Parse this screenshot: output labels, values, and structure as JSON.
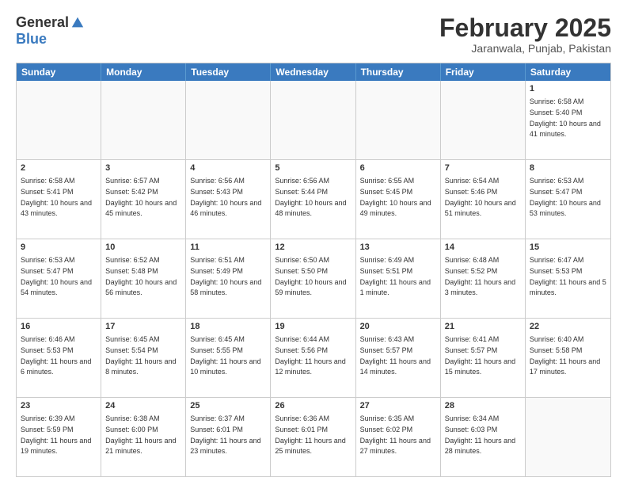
{
  "header": {
    "logo_general": "General",
    "logo_blue": "Blue",
    "month_title": "February 2025",
    "location": "Jaranwala, Punjab, Pakistan"
  },
  "days_of_week": [
    "Sunday",
    "Monday",
    "Tuesday",
    "Wednesday",
    "Thursday",
    "Friday",
    "Saturday"
  ],
  "weeks": [
    [
      {
        "day": "",
        "text": "",
        "empty": true
      },
      {
        "day": "",
        "text": "",
        "empty": true
      },
      {
        "day": "",
        "text": "",
        "empty": true
      },
      {
        "day": "",
        "text": "",
        "empty": true
      },
      {
        "day": "",
        "text": "",
        "empty": true
      },
      {
        "day": "",
        "text": "",
        "empty": true
      },
      {
        "day": "1",
        "text": "Sunrise: 6:58 AM\nSunset: 5:40 PM\nDaylight: 10 hours and 41 minutes.",
        "empty": false
      }
    ],
    [
      {
        "day": "2",
        "text": "Sunrise: 6:58 AM\nSunset: 5:41 PM\nDaylight: 10 hours and 43 minutes.",
        "empty": false
      },
      {
        "day": "3",
        "text": "Sunrise: 6:57 AM\nSunset: 5:42 PM\nDaylight: 10 hours and 45 minutes.",
        "empty": false
      },
      {
        "day": "4",
        "text": "Sunrise: 6:56 AM\nSunset: 5:43 PM\nDaylight: 10 hours and 46 minutes.",
        "empty": false
      },
      {
        "day": "5",
        "text": "Sunrise: 6:56 AM\nSunset: 5:44 PM\nDaylight: 10 hours and 48 minutes.",
        "empty": false
      },
      {
        "day": "6",
        "text": "Sunrise: 6:55 AM\nSunset: 5:45 PM\nDaylight: 10 hours and 49 minutes.",
        "empty": false
      },
      {
        "day": "7",
        "text": "Sunrise: 6:54 AM\nSunset: 5:46 PM\nDaylight: 10 hours and 51 minutes.",
        "empty": false
      },
      {
        "day": "8",
        "text": "Sunrise: 6:53 AM\nSunset: 5:47 PM\nDaylight: 10 hours and 53 minutes.",
        "empty": false
      }
    ],
    [
      {
        "day": "9",
        "text": "Sunrise: 6:53 AM\nSunset: 5:47 PM\nDaylight: 10 hours and 54 minutes.",
        "empty": false
      },
      {
        "day": "10",
        "text": "Sunrise: 6:52 AM\nSunset: 5:48 PM\nDaylight: 10 hours and 56 minutes.",
        "empty": false
      },
      {
        "day": "11",
        "text": "Sunrise: 6:51 AM\nSunset: 5:49 PM\nDaylight: 10 hours and 58 minutes.",
        "empty": false
      },
      {
        "day": "12",
        "text": "Sunrise: 6:50 AM\nSunset: 5:50 PM\nDaylight: 10 hours and 59 minutes.",
        "empty": false
      },
      {
        "day": "13",
        "text": "Sunrise: 6:49 AM\nSunset: 5:51 PM\nDaylight: 11 hours and 1 minute.",
        "empty": false
      },
      {
        "day": "14",
        "text": "Sunrise: 6:48 AM\nSunset: 5:52 PM\nDaylight: 11 hours and 3 minutes.",
        "empty": false
      },
      {
        "day": "15",
        "text": "Sunrise: 6:47 AM\nSunset: 5:53 PM\nDaylight: 11 hours and 5 minutes.",
        "empty": false
      }
    ],
    [
      {
        "day": "16",
        "text": "Sunrise: 6:46 AM\nSunset: 5:53 PM\nDaylight: 11 hours and 6 minutes.",
        "empty": false
      },
      {
        "day": "17",
        "text": "Sunrise: 6:45 AM\nSunset: 5:54 PM\nDaylight: 11 hours and 8 minutes.",
        "empty": false
      },
      {
        "day": "18",
        "text": "Sunrise: 6:45 AM\nSunset: 5:55 PM\nDaylight: 11 hours and 10 minutes.",
        "empty": false
      },
      {
        "day": "19",
        "text": "Sunrise: 6:44 AM\nSunset: 5:56 PM\nDaylight: 11 hours and 12 minutes.",
        "empty": false
      },
      {
        "day": "20",
        "text": "Sunrise: 6:43 AM\nSunset: 5:57 PM\nDaylight: 11 hours and 14 minutes.",
        "empty": false
      },
      {
        "day": "21",
        "text": "Sunrise: 6:41 AM\nSunset: 5:57 PM\nDaylight: 11 hours and 15 minutes.",
        "empty": false
      },
      {
        "day": "22",
        "text": "Sunrise: 6:40 AM\nSunset: 5:58 PM\nDaylight: 11 hours and 17 minutes.",
        "empty": false
      }
    ],
    [
      {
        "day": "23",
        "text": "Sunrise: 6:39 AM\nSunset: 5:59 PM\nDaylight: 11 hours and 19 minutes.",
        "empty": false
      },
      {
        "day": "24",
        "text": "Sunrise: 6:38 AM\nSunset: 6:00 PM\nDaylight: 11 hours and 21 minutes.",
        "empty": false
      },
      {
        "day": "25",
        "text": "Sunrise: 6:37 AM\nSunset: 6:01 PM\nDaylight: 11 hours and 23 minutes.",
        "empty": false
      },
      {
        "day": "26",
        "text": "Sunrise: 6:36 AM\nSunset: 6:01 PM\nDaylight: 11 hours and 25 minutes.",
        "empty": false
      },
      {
        "day": "27",
        "text": "Sunrise: 6:35 AM\nSunset: 6:02 PM\nDaylight: 11 hours and 27 minutes.",
        "empty": false
      },
      {
        "day": "28",
        "text": "Sunrise: 6:34 AM\nSunset: 6:03 PM\nDaylight: 11 hours and 28 minutes.",
        "empty": false
      },
      {
        "day": "",
        "text": "",
        "empty": true
      }
    ]
  ]
}
